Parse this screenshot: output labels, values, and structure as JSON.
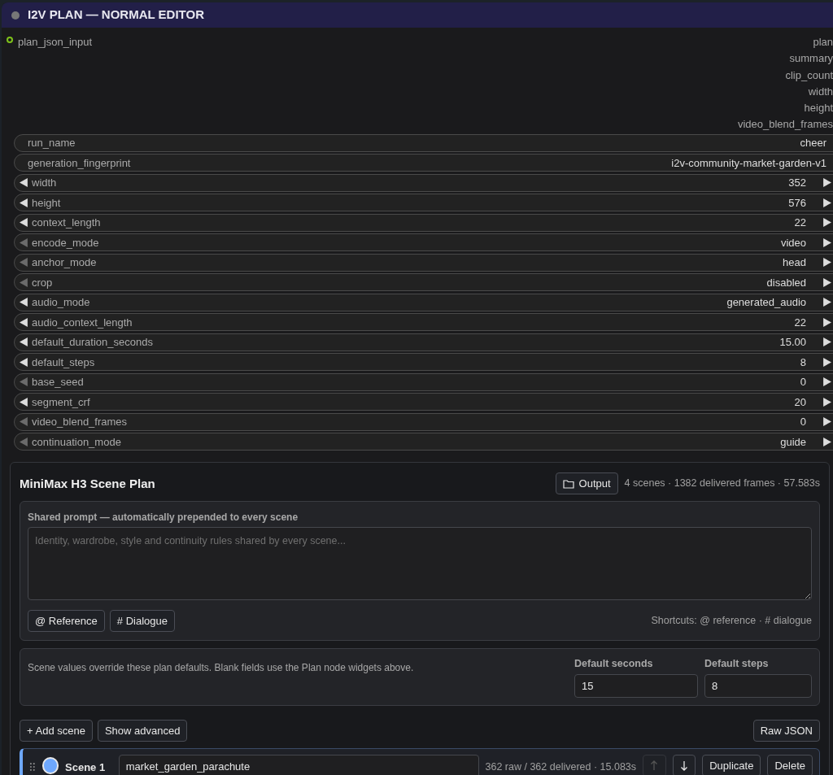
{
  "node": {
    "title": "I2V PLAN — NORMAL EDITOR",
    "input": {
      "label": "plan_json_input",
      "connected": true
    },
    "outputs": [
      "plan",
      "summary",
      "clip_count",
      "width",
      "height",
      "video_blend_frames"
    ],
    "widgets": [
      {
        "kind": "text",
        "name": "run_name",
        "value": "cheer"
      },
      {
        "kind": "text",
        "name": "generation_fingerprint",
        "value": "i2v-community-market-garden-v1"
      },
      {
        "kind": "stepper",
        "name": "width",
        "value": "352",
        "left_enabled": true
      },
      {
        "kind": "stepper",
        "name": "height",
        "value": "576",
        "left_enabled": true
      },
      {
        "kind": "stepper",
        "name": "context_length",
        "value": "22",
        "left_enabled": true
      },
      {
        "kind": "stepper",
        "name": "encode_mode",
        "value": "video",
        "left_enabled": false
      },
      {
        "kind": "stepper",
        "name": "anchor_mode",
        "value": "head",
        "left_enabled": false
      },
      {
        "kind": "stepper",
        "name": "crop",
        "value": "disabled",
        "left_enabled": false
      },
      {
        "kind": "stepper",
        "name": "audio_mode",
        "value": "generated_audio",
        "left_enabled": true
      },
      {
        "kind": "stepper",
        "name": "audio_context_length",
        "value": "22",
        "left_enabled": true
      },
      {
        "kind": "stepper",
        "name": "default_duration_seconds",
        "value": "15.00",
        "left_enabled": true
      },
      {
        "kind": "stepper",
        "name": "default_steps",
        "value": "8",
        "left_enabled": true
      },
      {
        "kind": "stepper",
        "name": "base_seed",
        "value": "0",
        "left_enabled": false
      },
      {
        "kind": "stepper",
        "name": "segment_crf",
        "value": "20",
        "left_enabled": true
      },
      {
        "kind": "stepper",
        "name": "video_blend_frames",
        "value": "0",
        "left_enabled": false
      },
      {
        "kind": "stepper",
        "name": "continuation_mode",
        "value": "guide",
        "left_enabled": false
      }
    ]
  },
  "panel": {
    "title": "MiniMax H3 Scene Plan",
    "output_button": "Output",
    "summary": "4 scenes · 1382 delivered frames · 57.583s",
    "shared_prompt": {
      "label": "Shared prompt — automatically prepended to every scene",
      "placeholder": "Identity, wardrobe, style and continuity rules shared by every scene...",
      "buttons": [
        "@ Reference",
        "# Dialogue"
      ],
      "shortcuts": "Shortcuts: @ reference · # dialogue"
    },
    "defaults": {
      "note": "Scene values override these plan defaults. Blank fields use the Plan node widgets above.",
      "fields": [
        {
          "label": "Default seconds",
          "value": "15"
        },
        {
          "label": "Default steps",
          "value": "8"
        }
      ]
    },
    "toolbar": {
      "left": [
        "+ Add scene",
        "Show advanced"
      ],
      "right": "Raw JSON"
    },
    "scenes": [
      {
        "label": "Scene 1",
        "color": "#6ea8fe",
        "name": "market_garden_parachute",
        "stats": "362 raw / 362 delivered · 15.083s",
        "up_enabled": false,
        "down_enabled": true,
        "actions": [
          "Duplicate",
          "Delete"
        ]
      }
    ]
  }
}
